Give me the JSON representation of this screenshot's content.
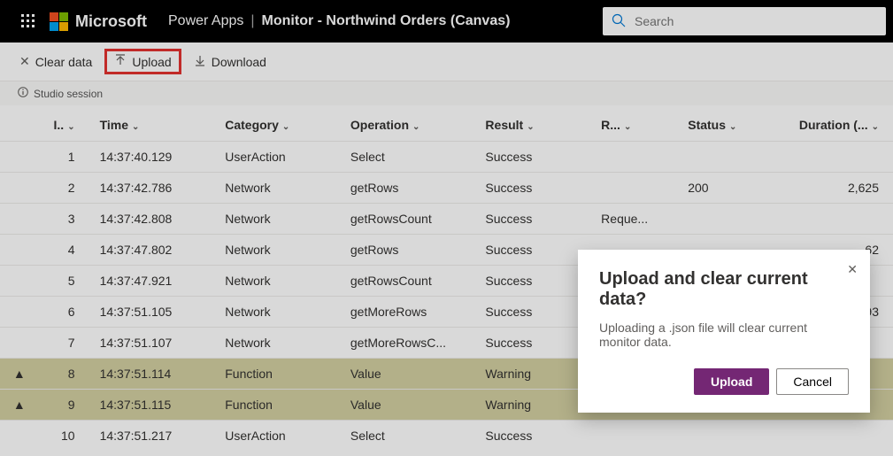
{
  "header": {
    "brand": "Microsoft",
    "app": "Power Apps",
    "page": "Monitor - Northwind Orders (Canvas)",
    "search_placeholder": "Search"
  },
  "toolbar": {
    "clear_label": "Clear data",
    "upload_label": "Upload",
    "download_label": "Download"
  },
  "session_bar": "Studio session",
  "columns": {
    "id": "I..",
    "time": "Time",
    "category": "Category",
    "operation": "Operation",
    "result": "Result",
    "row": "R...",
    "status": "Status",
    "duration": "Duration (..."
  },
  "rows": [
    {
      "id": "1",
      "time": "14:37:40.129",
      "category": "UserAction",
      "operation": "Select",
      "result": "Success",
      "row": "",
      "status": "",
      "duration": "",
      "warn": false
    },
    {
      "id": "2",
      "time": "14:37:42.786",
      "category": "Network",
      "operation": "getRows",
      "result": "Success",
      "row": "",
      "status": "200",
      "duration": "2,625",
      "warn": false
    },
    {
      "id": "3",
      "time": "14:37:42.808",
      "category": "Network",
      "operation": "getRowsCount",
      "result": "Success",
      "row": "Reque...",
      "status": "",
      "duration": "",
      "warn": false
    },
    {
      "id": "4",
      "time": "14:37:47.802",
      "category": "Network",
      "operation": "getRows",
      "result": "Success",
      "row": "",
      "status": "",
      "duration": "62",
      "warn": false
    },
    {
      "id": "5",
      "time": "14:37:47.921",
      "category": "Network",
      "operation": "getRowsCount",
      "result": "Success",
      "row": "",
      "status": "",
      "duration": "",
      "warn": false
    },
    {
      "id": "6",
      "time": "14:37:51.105",
      "category": "Network",
      "operation": "getMoreRows",
      "result": "Success",
      "row": "",
      "status": "",
      "duration": "93",
      "warn": false
    },
    {
      "id": "7",
      "time": "14:37:51.107",
      "category": "Network",
      "operation": "getMoreRowsC...",
      "result": "Success",
      "row": "",
      "status": "",
      "duration": "",
      "warn": false
    },
    {
      "id": "8",
      "time": "14:37:51.114",
      "category": "Function",
      "operation": "Value",
      "result": "Warning",
      "row": "",
      "status": "",
      "duration": "",
      "warn": true
    },
    {
      "id": "9",
      "time": "14:37:51.115",
      "category": "Function",
      "operation": "Value",
      "result": "Warning",
      "row": "",
      "status": "",
      "duration": "",
      "warn": true
    },
    {
      "id": "10",
      "time": "14:37:51.217",
      "category": "UserAction",
      "operation": "Select",
      "result": "Success",
      "row": "",
      "status": "",
      "duration": "",
      "warn": false
    }
  ],
  "dialog": {
    "title": "Upload and clear current data?",
    "body": "Uploading a .json file will clear current monitor data.",
    "primary": "Upload",
    "secondary": "Cancel"
  }
}
